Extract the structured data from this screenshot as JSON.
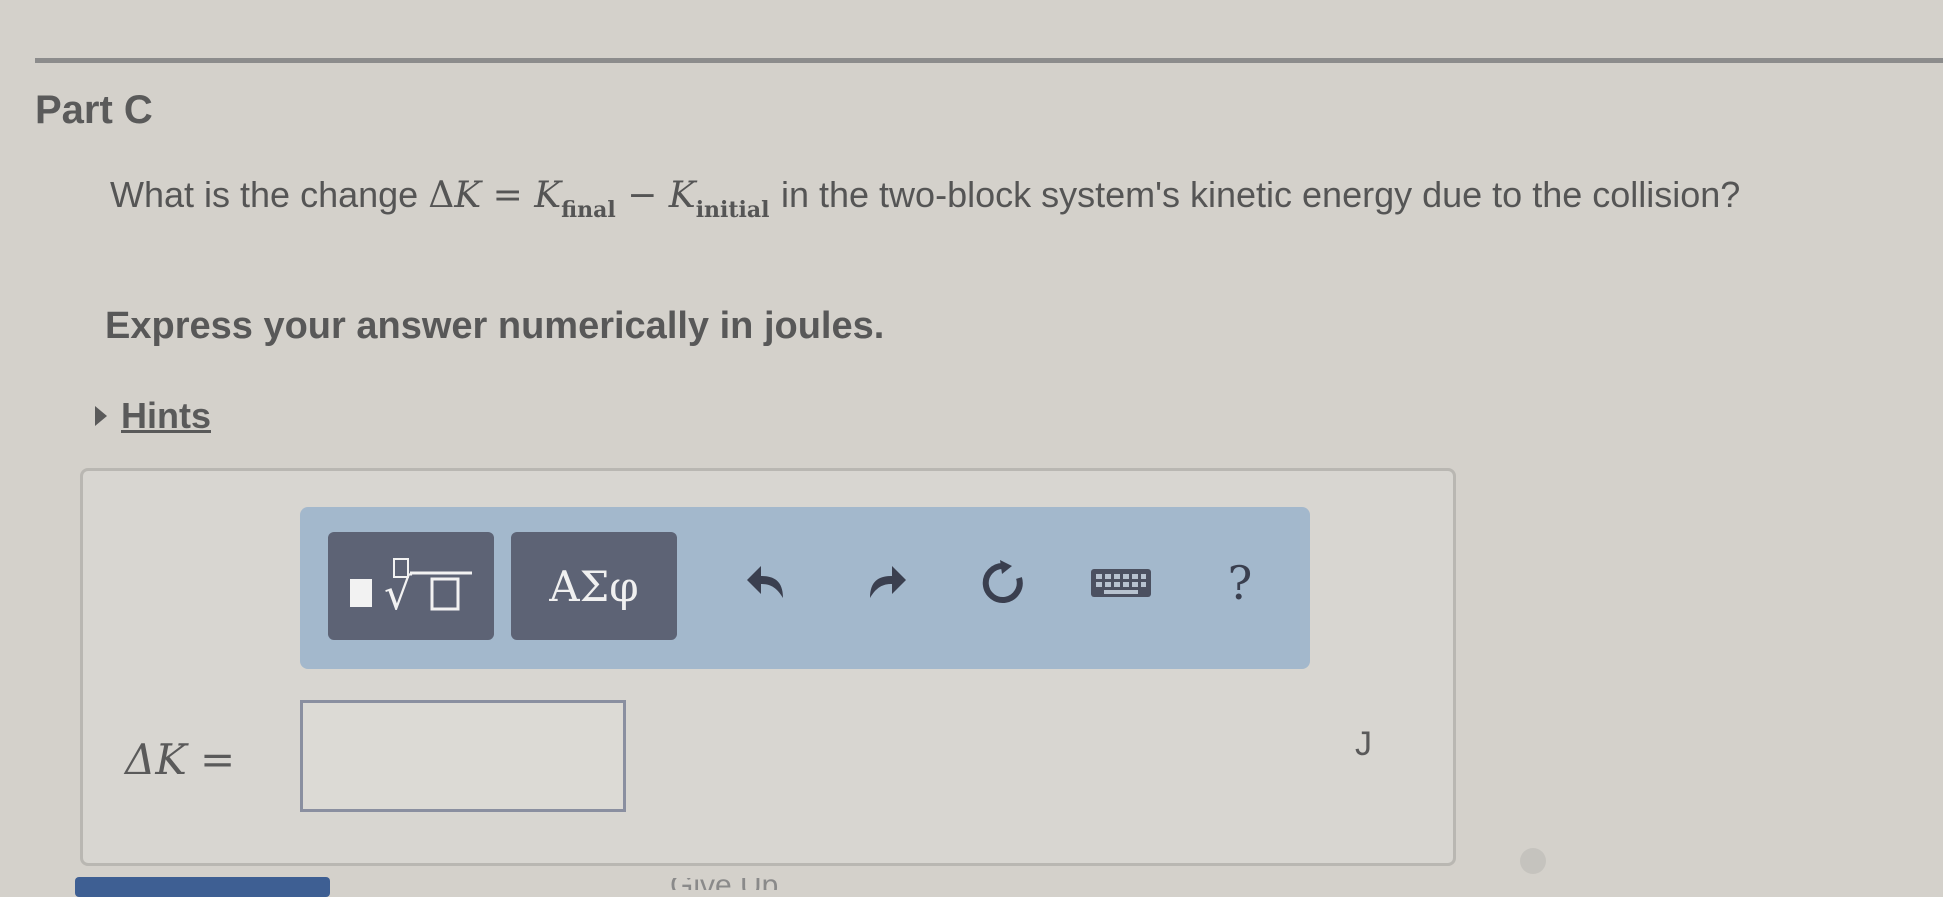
{
  "part_title": "Part C",
  "question": {
    "before": "What is the change",
    "delta": "Δ",
    "k": "K",
    "equals": "=",
    "minus": "−",
    "final_sub": "final",
    "initial_sub": "initial",
    "after": "in the two-block system's kinetic energy due to the collision?"
  },
  "instruction": "Express your answer numerically in joules.",
  "hints_label": "Hints",
  "toolbar": {
    "templates_label": "■√□",
    "symbols_label": "ΑΣφ",
    "help_label": "?",
    "icons": [
      "templates-icon",
      "undo-icon",
      "redo-icon",
      "reset-icon",
      "keyboard-icon",
      "help-icon"
    ]
  },
  "answer": {
    "label": "ΔK =",
    "value": "",
    "unit": "J"
  },
  "footer": {
    "give_up_label": "Give Up"
  },
  "colors": {
    "toolbar_bg": "#a3b8cc",
    "button_bg": "#5d6375",
    "submit_blue": "#3e5f93"
  }
}
